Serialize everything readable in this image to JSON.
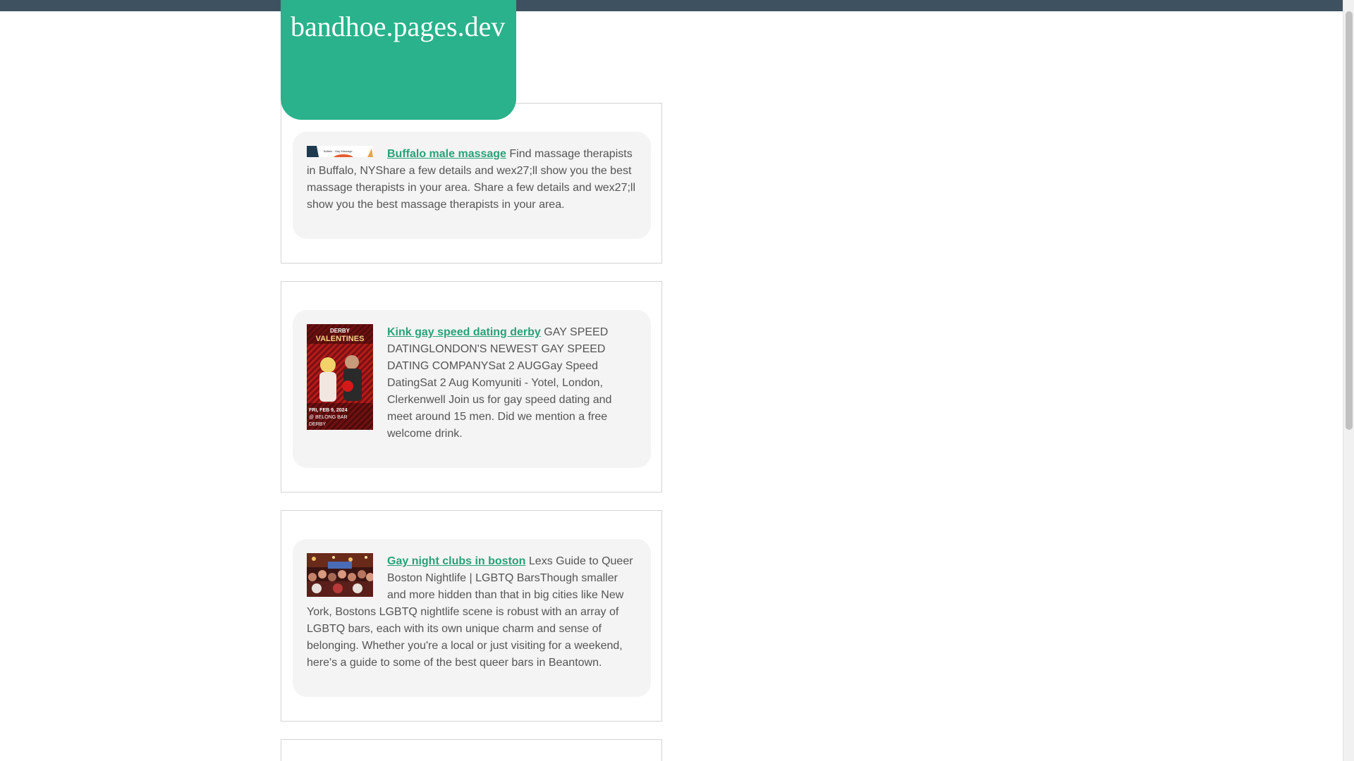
{
  "site": {
    "title": "bandhoe.pages.dev"
  },
  "colors": {
    "top_bar": "#3e5160",
    "brand": "#29b28b",
    "link": "#29a179",
    "card_bg": "#f4f4f4",
    "text": "#555555"
  },
  "articles": [
    {
      "title": "Buffalo male massage",
      "body": " Find massage therapists in Buffalo, NYShare a few details and wex27;ll show you the best massage therapists in your area. Share a few details and wex27;ll show you the best massage therapists in your area.",
      "thumbnail_icon": "massage-banner-thumbnail",
      "thumbnail_text": "Buffalo · Gay Massage"
    },
    {
      "title": "Kink gay speed dating derby",
      "body": " GAY SPEED DATINGLONDON'S NEWEST GAY SPEED DATING COMPANYSat 2 AUGGay Speed DatingSat 2 Aug Komyuniti - Yotel, London, Clerkenwell Join us for gay speed dating and meet around 15 men. Did we mention a free welcome drink.",
      "thumbnail_icon": "valentines-poster-thumbnail",
      "thumbnail_text": {
        "top": "DERBY",
        "headline": "VALENTINES",
        "date": "FRI, FEB 9, 2024",
        "venue": "@ BELONG BAR",
        "city": "DERBY"
      }
    },
    {
      "title": "Gay night clubs in boston",
      "body": " Lexs Guide to Queer Boston Nightlife | LGBTQ BarsThough smaller and more hidden than that in big cities like New York, Bostons LGBTQ nightlife scene is robust with an array of LGBTQ bars, each with its own unique charm and sense of belonging. Whether you're a local or just visiting for a weekend, here's a guide to some of the best queer bars in Beantown.",
      "thumbnail_icon": "nightclub-crowd-thumbnail"
    }
  ]
}
